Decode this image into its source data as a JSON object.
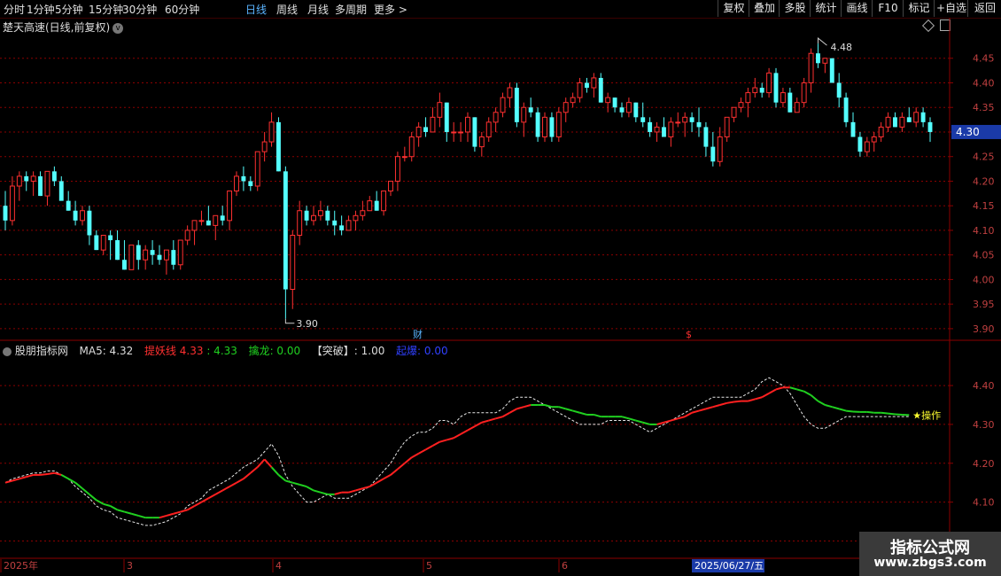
{
  "toolbar": {
    "left_tabs": [
      "分时",
      "1分钟",
      "5分钟",
      "15分钟",
      "30分钟",
      "60分钟",
      "日线",
      "周线",
      "月线",
      "多周期",
      "更多 >"
    ],
    "active_tab": "日线",
    "right_buttons": [
      "复权",
      "叠加",
      "多股",
      "统计",
      "画线",
      "F10",
      "标记",
      "+自选",
      "返回"
    ]
  },
  "stock": {
    "title": "楚天高速(日线,前复权)"
  },
  "price_axis": {
    "ticks": [
      "4.45",
      "4.40",
      "4.35",
      "4.30",
      "4.25",
      "4.20",
      "4.15",
      "4.10",
      "4.05",
      "4.00",
      "3.95",
      "3.90"
    ],
    "current": "4.30"
  },
  "annotations": {
    "high": "4.48",
    "low": "3.90",
    "event_cai": "财",
    "event_dollar": "$"
  },
  "indicator": {
    "name": "股朋指标网",
    "ma5_label": "MA5: 4.32",
    "tiyao_label": "提妖线",
    "tiyao_value1": "4.33",
    "tiyao_value2": ": 4.33",
    "qinlong_label": "擒龙: 0.00",
    "tupo_label": "【突破】: 1.00",
    "tiyao2_label": "起爆",
    "tiyao2_value": ": 0.00",
    "end_marker": "★操作",
    "axis_ticks": [
      "4.40",
      "4.30",
      "4.20",
      "4.10",
      "4.00"
    ]
  },
  "date_axis": {
    "labels": [
      "2025年",
      "3",
      "4",
      "5",
      "6"
    ],
    "highlight": "2025/06/27/五"
  },
  "watermark": {
    "line1": "指标公式网",
    "line2": "www.zbgs3.com"
  },
  "colors": {
    "up": "#ff3030",
    "down": "#54ffff",
    "grid_red": "#8b0000",
    "ma_up": "#ff2020",
    "ma_down": "#20d020"
  },
  "chart_data": {
    "type": "candlestick",
    "y_range": [
      3.88,
      4.5
    ],
    "ohlc": [
      [
        4.15,
        4.18,
        4.1,
        4.12
      ],
      [
        4.12,
        4.21,
        4.11,
        4.19
      ],
      [
        4.19,
        4.22,
        4.16,
        4.21
      ],
      [
        4.21,
        4.22,
        4.18,
        4.2
      ],
      [
        4.2,
        4.22,
        4.17,
        4.21
      ],
      [
        4.21,
        4.22,
        4.17,
        4.17
      ],
      [
        4.17,
        4.22,
        4.15,
        4.22
      ],
      [
        4.22,
        4.23,
        4.19,
        4.2
      ],
      [
        4.2,
        4.21,
        4.17,
        4.16
      ],
      [
        4.16,
        4.18,
        4.14,
        4.14
      ],
      [
        4.14,
        4.16,
        4.11,
        4.12
      ],
      [
        4.12,
        4.15,
        4.11,
        4.14
      ],
      [
        4.14,
        4.15,
        4.07,
        4.09
      ],
      [
        4.09,
        4.1,
        4.06,
        4.06
      ],
      [
        4.06,
        4.08,
        4.05,
        4.09
      ],
      [
        4.09,
        4.1,
        4.04,
        4.08
      ],
      [
        4.08,
        4.1,
        4.04,
        4.04
      ],
      [
        4.04,
        4.08,
        4.02,
        4.02
      ],
      [
        4.02,
        4.07,
        4.02,
        4.07
      ],
      [
        4.07,
        4.08,
        4.02,
        4.04
      ],
      [
        4.04,
        4.07,
        4.02,
        4.06
      ],
      [
        4.06,
        4.08,
        4.03,
        4.05
      ],
      [
        4.05,
        4.07,
        4.03,
        4.04
      ],
      [
        4.04,
        4.06,
        4.01,
        4.06
      ],
      [
        4.06,
        4.08,
        4.02,
        4.03
      ],
      [
        4.03,
        4.08,
        4.02,
        4.08
      ],
      [
        4.08,
        4.11,
        4.07,
        4.1
      ],
      [
        4.1,
        4.12,
        4.07,
        4.12
      ],
      [
        4.12,
        4.14,
        4.11,
        4.12
      ],
      [
        4.12,
        4.15,
        4.11,
        4.11
      ],
      [
        4.11,
        4.13,
        4.08,
        4.13
      ],
      [
        4.13,
        4.15,
        4.11,
        4.12
      ],
      [
        4.12,
        4.18,
        4.1,
        4.18
      ],
      [
        4.18,
        4.22,
        4.17,
        4.21
      ],
      [
        4.21,
        4.23,
        4.18,
        4.2
      ],
      [
        4.2,
        4.21,
        4.18,
        4.19
      ],
      [
        4.19,
        4.25,
        4.18,
        4.26
      ],
      [
        4.26,
        4.3,
        4.24,
        4.28
      ],
      [
        4.28,
        4.34,
        4.27,
        4.32
      ],
      [
        4.32,
        4.33,
        4.22,
        4.22
      ],
      [
        4.22,
        4.23,
        3.92,
        3.98
      ],
      [
        3.98,
        4.1,
        3.94,
        4.09
      ],
      [
        4.09,
        4.16,
        4.07,
        4.14
      ],
      [
        4.14,
        4.15,
        4.11,
        4.12
      ],
      [
        4.12,
        4.15,
        4.11,
        4.13
      ],
      [
        4.13,
        4.16,
        4.12,
        4.14
      ],
      [
        4.14,
        4.15,
        4.11,
        4.12
      ],
      [
        4.12,
        4.14,
        4.09,
        4.11
      ],
      [
        4.11,
        4.13,
        4.09,
        4.1
      ],
      [
        4.1,
        4.13,
        4.1,
        4.12
      ],
      [
        4.12,
        4.14,
        4.1,
        4.13
      ],
      [
        4.13,
        4.16,
        4.12,
        4.14
      ],
      [
        4.14,
        4.17,
        4.14,
        4.16
      ],
      [
        4.16,
        4.18,
        4.14,
        4.14
      ],
      [
        4.14,
        4.18,
        4.13,
        4.18
      ],
      [
        4.18,
        4.2,
        4.17,
        4.2
      ],
      [
        4.2,
        4.26,
        4.18,
        4.25
      ],
      [
        4.25,
        4.27,
        4.24,
        4.25
      ],
      [
        4.25,
        4.3,
        4.24,
        4.29
      ],
      [
        4.29,
        4.32,
        4.27,
        4.31
      ],
      [
        4.31,
        4.33,
        4.29,
        4.3
      ],
      [
        4.3,
        4.35,
        4.3,
        4.33
      ],
      [
        4.33,
        4.38,
        4.31,
        4.36
      ],
      [
        4.36,
        4.36,
        4.28,
        4.3
      ],
      [
        4.3,
        4.32,
        4.28,
        4.3
      ],
      [
        4.3,
        4.32,
        4.28,
        4.3
      ],
      [
        4.3,
        4.34,
        4.28,
        4.33
      ],
      [
        4.33,
        4.33,
        4.26,
        4.27
      ],
      [
        4.27,
        4.3,
        4.25,
        4.29
      ],
      [
        4.29,
        4.33,
        4.28,
        4.32
      ],
      [
        4.32,
        4.35,
        4.3,
        4.34
      ],
      [
        4.34,
        4.38,
        4.33,
        4.37
      ],
      [
        4.37,
        4.4,
        4.35,
        4.39
      ],
      [
        4.39,
        4.4,
        4.31,
        4.32
      ],
      [
        4.32,
        4.36,
        4.29,
        4.35
      ],
      [
        4.35,
        4.37,
        4.33,
        4.34
      ],
      [
        4.34,
        4.35,
        4.28,
        4.29
      ],
      [
        4.29,
        4.34,
        4.28,
        4.33
      ],
      [
        4.33,
        4.34,
        4.28,
        4.29
      ],
      [
        4.29,
        4.35,
        4.28,
        4.34
      ],
      [
        4.34,
        4.37,
        4.32,
        4.36
      ],
      [
        4.36,
        4.38,
        4.35,
        4.37
      ],
      [
        4.37,
        4.41,
        4.36,
        4.4
      ],
      [
        4.4,
        4.41,
        4.38,
        4.39
      ],
      [
        4.39,
        4.42,
        4.37,
        4.41
      ],
      [
        4.41,
        4.42,
        4.36,
        4.36
      ],
      [
        4.36,
        4.38,
        4.34,
        4.37
      ],
      [
        4.37,
        4.37,
        4.34,
        4.35
      ],
      [
        4.35,
        4.36,
        4.33,
        4.34
      ],
      [
        4.34,
        4.37,
        4.33,
        4.36
      ],
      [
        4.36,
        4.36,
        4.32,
        4.33
      ],
      [
        4.33,
        4.36,
        4.31,
        4.32
      ],
      [
        4.32,
        4.33,
        4.29,
        4.3
      ],
      [
        4.3,
        4.32,
        4.28,
        4.31
      ],
      [
        4.31,
        4.33,
        4.29,
        4.29
      ],
      [
        4.29,
        4.33,
        4.27,
        4.32
      ],
      [
        4.32,
        4.34,
        4.31,
        4.32
      ],
      [
        4.32,
        4.34,
        4.29,
        4.33
      ],
      [
        4.33,
        4.34,
        4.3,
        4.32
      ],
      [
        4.32,
        4.35,
        4.29,
        4.31
      ],
      [
        4.31,
        4.32,
        4.25,
        4.27
      ],
      [
        4.27,
        4.3,
        4.23,
        4.24
      ],
      [
        4.24,
        4.31,
        4.23,
        4.29
      ],
      [
        4.29,
        4.33,
        4.28,
        4.33
      ],
      [
        4.33,
        4.35,
        4.32,
        4.35
      ],
      [
        4.35,
        4.37,
        4.34,
        4.36
      ],
      [
        4.36,
        4.39,
        4.33,
        4.38
      ],
      [
        4.38,
        4.41,
        4.37,
        4.39
      ],
      [
        4.39,
        4.4,
        4.37,
        4.38
      ],
      [
        4.38,
        4.43,
        4.37,
        4.42
      ],
      [
        4.42,
        4.43,
        4.35,
        4.36
      ],
      [
        4.36,
        4.39,
        4.35,
        4.38
      ],
      [
        4.38,
        4.39,
        4.34,
        4.34
      ],
      [
        4.34,
        4.37,
        4.34,
        4.36
      ],
      [
        4.36,
        4.41,
        4.35,
        4.4
      ],
      [
        4.4,
        4.47,
        4.38,
        4.46
      ],
      [
        4.46,
        4.48,
        4.43,
        4.44
      ],
      [
        4.44,
        4.45,
        4.42,
        4.45
      ],
      [
        4.45,
        4.45,
        4.4,
        4.4
      ],
      [
        4.4,
        4.42,
        4.35,
        4.37
      ],
      [
        4.37,
        4.38,
        4.31,
        4.32
      ],
      [
        4.32,
        4.34,
        4.29,
        4.29
      ],
      [
        4.29,
        4.3,
        4.25,
        4.26
      ],
      [
        4.26,
        4.29,
        4.25,
        4.28
      ],
      [
        4.28,
        4.3,
        4.26,
        4.29
      ],
      [
        4.29,
        4.32,
        4.28,
        4.31
      ],
      [
        4.31,
        4.34,
        4.3,
        4.33
      ],
      [
        4.33,
        4.34,
        4.31,
        4.31
      ],
      [
        4.31,
        4.34,
        4.3,
        4.33
      ],
      [
        4.33,
        4.35,
        4.32,
        4.32
      ],
      [
        4.32,
        4.35,
        4.31,
        4.34
      ],
      [
        4.34,
        4.35,
        4.31,
        4.32
      ],
      [
        4.32,
        4.33,
        4.28,
        4.3
      ]
    ],
    "ind_range": [
      3.96,
      4.48
    ],
    "ma_line": [
      4.15,
      4.155,
      4.16,
      4.165,
      4.17,
      4.17,
      4.172,
      4.175,
      4.17,
      4.16,
      4.15,
      4.135,
      4.12,
      4.105,
      4.095,
      4.09,
      4.08,
      4.075,
      4.07,
      4.065,
      4.06,
      4.06,
      4.06,
      4.065,
      4.07,
      4.075,
      4.08,
      4.09,
      4.1,
      4.11,
      4.12,
      4.13,
      4.14,
      4.15,
      4.16,
      4.175,
      4.19,
      4.21,
      4.19,
      4.17,
      4.155,
      4.15,
      4.145,
      4.14,
      4.13,
      4.125,
      4.12,
      4.12,
      4.125,
      4.125,
      4.13,
      4.135,
      4.14,
      4.15,
      4.16,
      4.17,
      4.185,
      4.2,
      4.215,
      4.225,
      4.235,
      4.245,
      4.255,
      4.26,
      4.265,
      4.275,
      4.285,
      4.295,
      4.305,
      4.31,
      4.315,
      4.32,
      4.33,
      4.34,
      4.345,
      4.35,
      4.35,
      4.35,
      4.345,
      4.345,
      4.34,
      4.335,
      4.33,
      4.325,
      4.325,
      4.32,
      4.32,
      4.32,
      4.32,
      4.315,
      4.31,
      4.305,
      4.3,
      4.3,
      4.305,
      4.31,
      4.315,
      4.32,
      4.33,
      4.335,
      4.34,
      4.345,
      4.35,
      4.355,
      4.358,
      4.36,
      4.36,
      4.365,
      4.37,
      4.38,
      4.39,
      4.395,
      4.395,
      4.39,
      4.385,
      4.375,
      4.36,
      4.35,
      4.345,
      4.34,
      4.335,
      4.333,
      4.332,
      4.332,
      4.33,
      4.33,
      4.328,
      4.326,
      4.325,
      4.324
    ],
    "ma_color": [
      "u",
      "u",
      "u",
      "u",
      "u",
      "u",
      "u",
      "u",
      "d",
      "d",
      "d",
      "d",
      "d",
      "d",
      "d",
      "d",
      "d",
      "d",
      "d",
      "d",
      "d",
      "d",
      "u",
      "u",
      "u",
      "u",
      "u",
      "u",
      "u",
      "u",
      "u",
      "u",
      "u",
      "u",
      "u",
      "u",
      "u",
      "u",
      "d",
      "d",
      "d",
      "d",
      "d",
      "d",
      "d",
      "d",
      "d",
      "u",
      "u",
      "u",
      "u",
      "u",
      "u",
      "u",
      "u",
      "u",
      "u",
      "u",
      "u",
      "u",
      "u",
      "u",
      "u",
      "u",
      "u",
      "u",
      "u",
      "u",
      "u",
      "u",
      "u",
      "u",
      "u",
      "u",
      "u",
      "d",
      "d",
      "d",
      "d",
      "d",
      "d",
      "d",
      "d",
      "d",
      "d",
      "d",
      "d",
      "d",
      "d",
      "d",
      "d",
      "d",
      "d",
      "u",
      "u",
      "u",
      "u",
      "u",
      "u",
      "u",
      "u",
      "u",
      "u",
      "u",
      "u",
      "u",
      "u",
      "u",
      "u",
      "u",
      "u",
      "u",
      "d",
      "d",
      "d",
      "d",
      "d",
      "d",
      "d",
      "d",
      "d",
      "d",
      "d",
      "d",
      "d",
      "d",
      "d",
      "d",
      "d",
      "d",
      "d",
      "d"
    ],
    "dash_line": [
      4.15,
      4.16,
      4.165,
      4.17,
      4.175,
      4.175,
      4.18,
      4.18,
      4.17,
      4.16,
      4.14,
      4.125,
      4.11,
      4.09,
      4.08,
      4.075,
      4.06,
      4.055,
      4.05,
      4.045,
      4.04,
      4.04,
      4.045,
      4.05,
      4.06,
      4.07,
      4.09,
      4.1,
      4.11,
      4.13,
      4.14,
      4.15,
      4.16,
      4.175,
      4.19,
      4.2,
      4.21,
      4.23,
      4.25,
      4.22,
      4.17,
      4.14,
      4.12,
      4.1,
      4.1,
      4.11,
      4.12,
      4.11,
      4.11,
      4.11,
      4.12,
      4.13,
      4.14,
      4.16,
      4.18,
      4.2,
      4.23,
      4.255,
      4.27,
      4.28,
      4.28,
      4.29,
      4.31,
      4.31,
      4.3,
      4.32,
      4.33,
      4.33,
      4.33,
      4.33,
      4.33,
      4.34,
      4.36,
      4.37,
      4.37,
      4.37,
      4.36,
      4.35,
      4.34,
      4.33,
      4.32,
      4.31,
      4.3,
      4.3,
      4.3,
      4.3,
      4.31,
      4.31,
      4.31,
      4.31,
      4.3,
      4.29,
      4.28,
      4.29,
      4.3,
      4.31,
      4.32,
      4.33,
      4.34,
      4.35,
      4.36,
      4.37,
      4.37,
      4.37,
      4.37,
      4.37,
      4.38,
      4.39,
      4.41,
      4.42,
      4.41,
      4.4,
      4.38,
      4.35,
      4.32,
      4.3,
      4.29,
      4.29,
      4.3,
      4.31,
      4.32,
      4.32,
      4.32,
      4.32,
      4.32,
      4.32,
      4.32,
      4.32,
      4.32,
      4.32
    ]
  }
}
